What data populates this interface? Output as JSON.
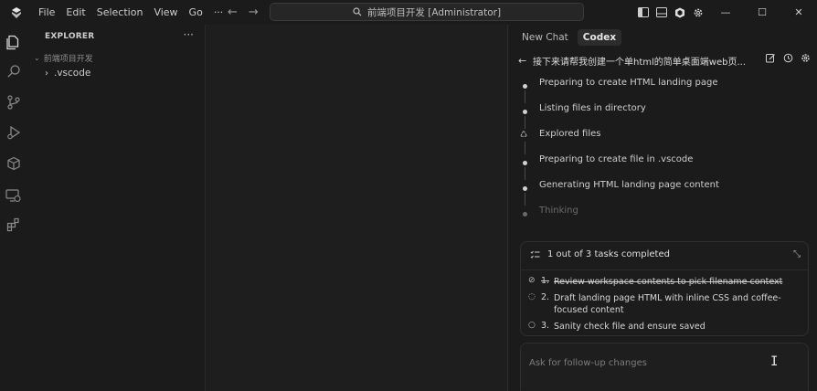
{
  "menu": {
    "items": [
      "File",
      "Edit",
      "Selection",
      "View",
      "Go",
      "···"
    ]
  },
  "command_center": {
    "text": "前端项目开发 [Administrator]"
  },
  "window_controls": {
    "minimize": "—",
    "maximize": "☐",
    "close": "✕"
  },
  "sidebar": {
    "title": "EXPLORER",
    "more": "···",
    "folder": "前端项目开发",
    "items": [
      {
        "label": ".vscode"
      }
    ]
  },
  "chat": {
    "tabs": [
      {
        "label": "New Chat"
      },
      {
        "label": "Codex"
      }
    ],
    "active_tab": "Codex",
    "thread_title": "接下来请帮我创建一个单html的简单桌面端web页...",
    "steps": [
      {
        "label": "Preparing to create HTML landing page"
      },
      {
        "label": "Listing files in directory"
      },
      {
        "label": "Explored files"
      },
      {
        "label": "Preparing to create file in .vscode"
      },
      {
        "label": "Generating HTML landing page content"
      },
      {
        "label": "Thinking"
      }
    ],
    "tasks": {
      "summary": "1 out of 3 tasks completed",
      "items": [
        {
          "num": "1.",
          "text": "Review workspace contents to pick filename context",
          "status": "done"
        },
        {
          "num": "2.",
          "text": "Draft landing page HTML with inline CSS and coffee-focused content",
          "status": "in-progress"
        },
        {
          "num": "3.",
          "text": "Sanity check file and ensure saved",
          "status": "pending"
        }
      ]
    },
    "input": {
      "placeholder": "Ask for follow-up changes",
      "value": ""
    }
  }
}
